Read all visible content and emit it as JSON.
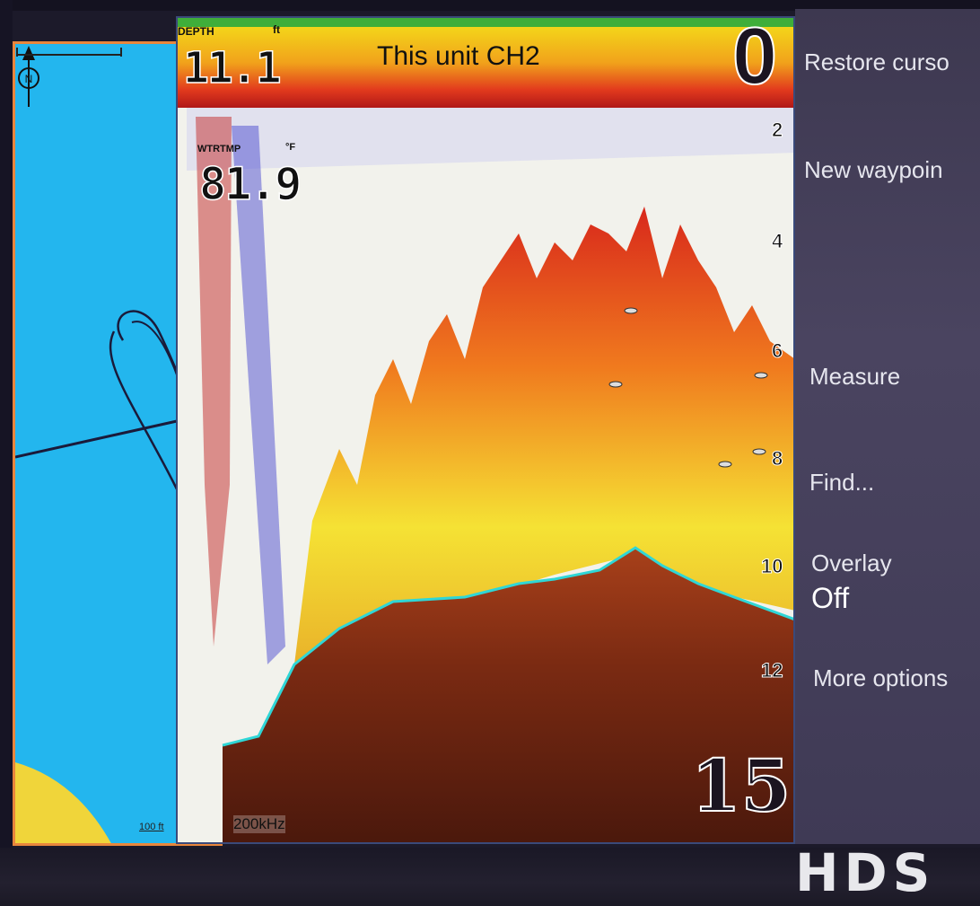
{
  "sonar": {
    "channel_title": "This unit CH2",
    "depth_label": "DEPTH",
    "depth_unit": "ft",
    "depth_value": "11.1",
    "water_temp_label": "WTRTMP",
    "water_temp_unit": "°F",
    "water_temp_value": "81.9",
    "range_top": "0",
    "range_bottom": "15",
    "depth_ticks": [
      "2",
      "4",
      "6",
      "8",
      "10",
      "12"
    ],
    "frequency": "200kHz"
  },
  "chart": {
    "scale_label": "100 ft",
    "north_label": "N"
  },
  "menu": {
    "restore_cursor": "Restore curso",
    "new_waypoint": "New waypoin",
    "measure": "Measure",
    "find": "Find...",
    "overlay_label": "Overlay",
    "overlay_value": "Off",
    "more_options": "More options"
  },
  "brand": {
    "logo": "HDS"
  },
  "colors": {
    "chart_water": "#23b6ee",
    "chart_border": "#e8863c",
    "bottom_line": "#2fd6d6",
    "menu_bg": "#433d58"
  }
}
